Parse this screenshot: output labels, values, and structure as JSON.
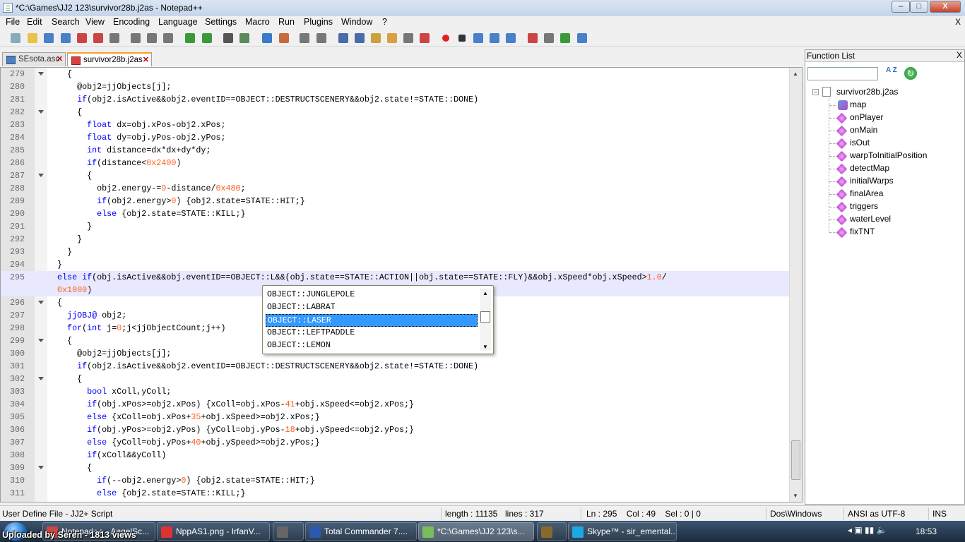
{
  "window": {
    "title": "*C:\\Games\\JJ2 123\\survivor28b.j2as - Notepad++",
    "min": "–",
    "max": "□",
    "close": "X"
  },
  "menu": {
    "items": [
      "File",
      "Edit",
      "Search",
      "View",
      "Encoding",
      "Language",
      "Settings",
      "Macro",
      "Run",
      "Plugins",
      "Window",
      "?"
    ],
    "close": "X"
  },
  "toolbar_icons": [
    "new-icon",
    "open-icon",
    "save-icon",
    "save-all-icon",
    "close-icon",
    "close-all-icon",
    "print-icon",
    "cut-icon",
    "copy-icon",
    "paste-icon",
    "undo-icon",
    "redo-icon",
    "find-icon",
    "replace-icon",
    "zoom-in-icon",
    "zoom-out-icon",
    "sync-v-icon",
    "sync-h-icon",
    "word-wrap-icon",
    "show-all-chars-icon",
    "indent-guide-icon",
    "udl-icon",
    "doc-map-icon",
    "function-list-icon",
    "record-macro-icon",
    "stop-record-icon",
    "play-macro-icon",
    "run-macro-multi-icon",
    "save-macro-icon",
    "spell-check-icon",
    "spell-settings-icon",
    "preview-icon",
    "check-icon"
  ],
  "tabs": [
    {
      "label": "SEsota.asc",
      "close": "✕"
    },
    {
      "label": "survivor28b.j2as",
      "close": "✕"
    }
  ],
  "editor": {
    "lines": [
      {
        "n": "279",
        "fold": true,
        "code": [
          [
            "op",
            "    {"
          ]
        ]
      },
      {
        "n": "280",
        "code": [
          [
            "op",
            "      @obj2=jjObjects[j];"
          ]
        ]
      },
      {
        "n": "281",
        "code": [
          [
            "kw",
            "      if"
          ],
          [
            "op",
            "(obj2.isActive&&obj2.eventID==OBJECT::DESTRUCTSCENERY&&obj2.state!=STATE::DONE)"
          ]
        ]
      },
      {
        "n": "282",
        "fold": true,
        "code": [
          [
            "op",
            "      {"
          ]
        ]
      },
      {
        "n": "283",
        "code": [
          [
            "kw",
            "        float"
          ],
          [
            "op",
            " dx=obj.xPos-obj2.xPos;"
          ]
        ]
      },
      {
        "n": "284",
        "code": [
          [
            "kw",
            "        float"
          ],
          [
            "op",
            " dy=obj.yPos-obj2.yPos;"
          ]
        ]
      },
      {
        "n": "285",
        "code": [
          [
            "kw",
            "        int"
          ],
          [
            "op",
            " distance=dx*dx+dy*dy;"
          ]
        ]
      },
      {
        "n": "286",
        "code": [
          [
            "kw",
            "        if"
          ],
          [
            "op",
            "(distance<"
          ],
          [
            "num",
            "0x2400"
          ],
          [
            "op",
            ")"
          ]
        ]
      },
      {
        "n": "287",
        "fold": true,
        "code": [
          [
            "op",
            "        {"
          ]
        ]
      },
      {
        "n": "288",
        "code": [
          [
            "op",
            "          obj2.energy-="
          ],
          [
            "num",
            "9"
          ],
          [
            "op",
            "-distance/"
          ],
          [
            "num",
            "0x480"
          ],
          [
            "op",
            ";"
          ]
        ]
      },
      {
        "n": "289",
        "code": [
          [
            "kw",
            "          if"
          ],
          [
            "op",
            "(obj2.energy>"
          ],
          [
            "num",
            "0"
          ],
          [
            "op",
            ") {obj2.state=STATE::HIT;}"
          ]
        ]
      },
      {
        "n": "290",
        "code": [
          [
            "kw",
            "          else"
          ],
          [
            "op",
            " {obj2.state=STATE::KILL;}"
          ]
        ]
      },
      {
        "n": "291",
        "code": [
          [
            "op",
            "        }"
          ]
        ]
      },
      {
        "n": "292",
        "code": [
          [
            "op",
            "      }"
          ]
        ]
      },
      {
        "n": "293",
        "code": [
          [
            "op",
            "    }"
          ]
        ]
      },
      {
        "n": "294",
        "code": [
          [
            "op",
            "  }"
          ]
        ]
      },
      {
        "n": "295",
        "current": true,
        "code": [
          [
            "kw",
            "  else if"
          ],
          [
            "op",
            "(obj.isActive&&obj.eventID==OBJECT::L&&(obj.state==STATE::ACTION||obj.state==STATE::FLY)&&obj.xSpeed*obj.xSpeed>"
          ],
          [
            "num",
            "1.0"
          ],
          [
            "op",
            "/"
          ]
        ]
      },
      {
        "n": "",
        "current": true,
        "code": [
          [
            "num",
            "  0x1000"
          ],
          [
            "op",
            ")"
          ]
        ]
      },
      {
        "n": "296",
        "fold": true,
        "code": [
          [
            "op",
            "  {"
          ]
        ]
      },
      {
        "n": "297",
        "code": [
          [
            "kw",
            "    jjOBJ@"
          ],
          [
            "op",
            " obj2;"
          ]
        ]
      },
      {
        "n": "298",
        "code": [
          [
            "kw",
            "    for"
          ],
          [
            "op",
            "("
          ],
          [
            "kw",
            "int"
          ],
          [
            "op",
            " j="
          ],
          [
            "num",
            "0"
          ],
          [
            "op",
            ";j<jjObjectCount;j++)"
          ]
        ]
      },
      {
        "n": "299",
        "fold": true,
        "code": [
          [
            "op",
            "    {"
          ]
        ]
      },
      {
        "n": "300",
        "code": [
          [
            "op",
            "      @obj2=jjObjects[j];"
          ]
        ]
      },
      {
        "n": "301",
        "code": [
          [
            "kw",
            "      if"
          ],
          [
            "op",
            "(obj2.isActive&&obj2.eventID==OBJECT::DESTRUCTSCENERY&&obj2.state!=STATE::DONE)"
          ]
        ]
      },
      {
        "n": "302",
        "fold": true,
        "code": [
          [
            "op",
            "      {"
          ]
        ]
      },
      {
        "n": "303",
        "code": [
          [
            "kw",
            "        bool"
          ],
          [
            "op",
            " xColl,yColl;"
          ]
        ]
      },
      {
        "n": "304",
        "code": [
          [
            "kw",
            "        if"
          ],
          [
            "op",
            "(obj.xPos>=obj2.xPos) {xColl=obj.xPos-"
          ],
          [
            "num",
            "41"
          ],
          [
            "op",
            "+obj.xSpeed<=obj2.xPos;}"
          ]
        ]
      },
      {
        "n": "305",
        "code": [
          [
            "kw",
            "        else"
          ],
          [
            "op",
            " {xColl=obj.xPos+"
          ],
          [
            "num",
            "35"
          ],
          [
            "op",
            "+obj.xSpeed>=obj2.xPos;}"
          ]
        ]
      },
      {
        "n": "306",
        "code": [
          [
            "kw",
            "        if"
          ],
          [
            "op",
            "(obj.yPos>=obj2.yPos) {yColl=obj.yPos-"
          ],
          [
            "num",
            "18"
          ],
          [
            "op",
            "+obj.ySpeed<=obj2.yPos;}"
          ]
        ]
      },
      {
        "n": "307",
        "code": [
          [
            "kw",
            "        else"
          ],
          [
            "op",
            " {yColl=obj.yPos+"
          ],
          [
            "num",
            "40"
          ],
          [
            "op",
            "+obj.ySpeed>=obj2.yPos;}"
          ]
        ]
      },
      {
        "n": "308",
        "code": [
          [
            "kw",
            "        if"
          ],
          [
            "op",
            "(xColl&&yColl)"
          ]
        ]
      },
      {
        "n": "309",
        "fold": true,
        "code": [
          [
            "op",
            "        {"
          ]
        ]
      },
      {
        "n": "310",
        "code": [
          [
            "kw",
            "          if"
          ],
          [
            "op",
            "(--obj2.energy>"
          ],
          [
            "num",
            "0"
          ],
          [
            "op",
            ") {obj2.state=STATE::HIT;}"
          ]
        ]
      },
      {
        "n": "311",
        "code": [
          [
            "kw",
            "          else"
          ],
          [
            "op",
            " {obj2.state=STATE::KILL;}"
          ]
        ]
      }
    ]
  },
  "autocomplete": {
    "items": [
      "OBJECT::JUNGLEPOLE",
      "OBJECT::LABRAT",
      "OBJECT::LASER",
      "OBJECT::LEFTPADDLE",
      "OBJECT::LEMON"
    ],
    "selected_index": 2
  },
  "function_list": {
    "title": "Function List",
    "close": "X",
    "sort_label": "A Z",
    "reload_label": "↻",
    "search_value": "",
    "root": "survivor28b.j2as",
    "root_expander": "−",
    "items": [
      "map",
      "onPlayer",
      "onMain",
      "isOut",
      "warpToInitialPosition",
      "detectMap",
      "initialWarps",
      "finalArea",
      "triggers",
      "waterLevel",
      "fixTNT"
    ]
  },
  "status": {
    "file_type": "User Define File - JJ2+ Script",
    "length": "length : 11135",
    "lines": "lines : 317",
    "position": "Ln : 295    Col : 49    Sel : 0 | 0",
    "eol": "Dos\\Windows",
    "encoding": "ANSI as UTF-8",
    "mode": "INS"
  },
  "taskbar": {
    "items": [
      {
        "label": "Notepad++ - AngelSc...",
        "color": "#c44"
      },
      {
        "label": "NppAS1.png - IrfanV...",
        "color": "#d33"
      },
      {
        "label": "",
        "color": "#666"
      },
      {
        "label": "Total Commander 7....",
        "color": "#2a5ab0"
      },
      {
        "label": "*C:\\Games\\JJ2 123\\s...",
        "color": "#7bbd5a"
      },
      {
        "label": "",
        "color": "#8a6a2a"
      },
      {
        "label": "Skype™ - sir_emental...",
        "color": "#1ba9e1"
      }
    ],
    "clock": "18:53"
  },
  "watermark": "Uploaded by Seren - 1813 views"
}
